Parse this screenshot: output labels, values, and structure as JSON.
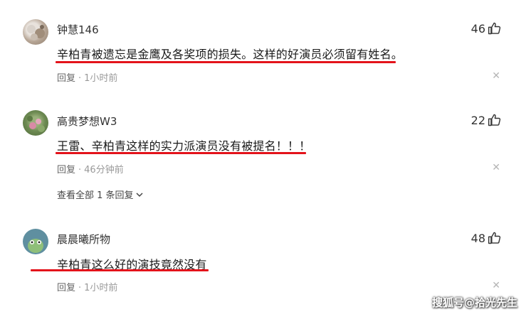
{
  "comments": [
    {
      "username": "钟慧146",
      "likes": "46",
      "text": "辛柏青被遗忘是金鹰及各奖项的损失。这样的好演员必须留有姓名。",
      "reply_label": "回复",
      "time": "1小时前"
    },
    {
      "username": "高贵梦想W3",
      "likes": "22",
      "text": "王雷、辛柏青这样的实力派演员没有被提名！！！",
      "reply_label": "回复",
      "time": "46分钟前",
      "view_replies": "查看全部 1 条回复"
    },
    {
      "username": "晨晨曦所物",
      "likes": "48",
      "text": "辛柏青这么好的演技竟然没有",
      "reply_label": "回复",
      "time": "1小时前"
    }
  ],
  "watermark": "搜狐号@拾光先生",
  "colors": {
    "underline": "#e3131b",
    "meta": "#999999"
  },
  "icons": {
    "like": "thumbs-up-icon",
    "close": "close-icon",
    "expand": "chevron-down-icon"
  }
}
